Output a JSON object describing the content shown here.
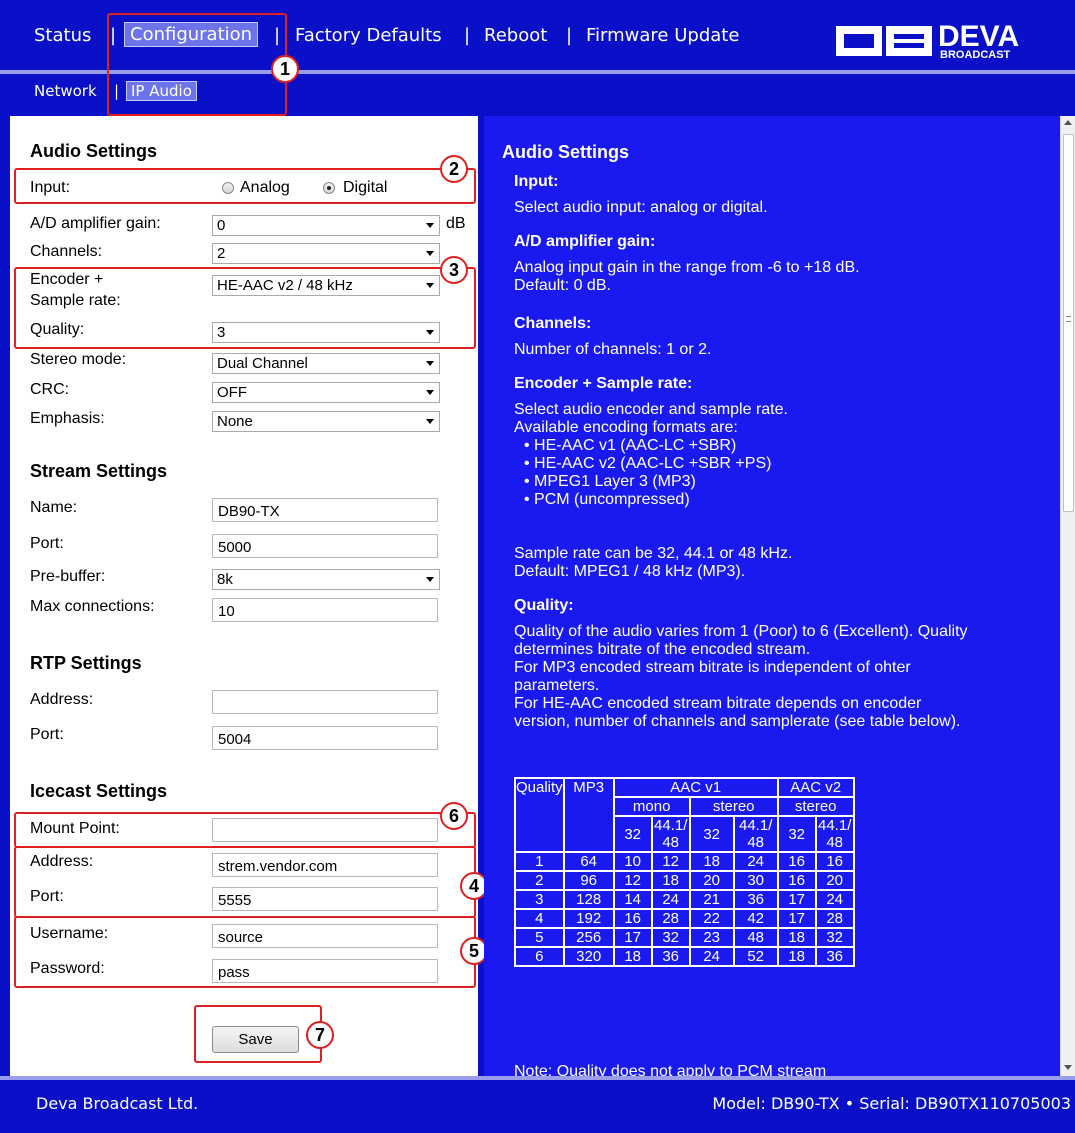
{
  "nav": {
    "items": [
      "Status",
      "Configuration",
      "Factory Defaults",
      "Reboot",
      "Firmware Update"
    ],
    "active": "Configuration",
    "separator": "|"
  },
  "subnav": {
    "items": [
      "Network",
      "IP Audio"
    ],
    "active": "IP Audio",
    "separator": "|"
  },
  "logo": {
    "main": "DEVA",
    "sub": "BROADCAST"
  },
  "audio": {
    "heading": "Audio Settings",
    "input_label": "Input:",
    "input_options": [
      "Analog",
      "Digital"
    ],
    "input_selected": "Digital",
    "gain_label": "A/D amplifier gain:",
    "gain_value": "0",
    "gain_unit": "dB",
    "channels_label": "Channels:",
    "channels_value": "2",
    "encoder_label_1": "Encoder +",
    "encoder_label_2": "Sample rate:",
    "encoder_value": "HE-AAC v2 / 48 kHz",
    "quality_label": "Quality:",
    "quality_value": "3",
    "stereo_label": "Stereo mode:",
    "stereo_value": "Dual Channel",
    "crc_label": "CRC:",
    "crc_value": "OFF",
    "emphasis_label": "Emphasis:",
    "emphasis_value": "None"
  },
  "stream": {
    "heading": "Stream Settings",
    "name_label": "Name:",
    "name_value": "DB90-TX",
    "port_label": "Port:",
    "port_value": "5000",
    "prebuffer_label": "Pre-buffer:",
    "prebuffer_value": "8k",
    "maxconn_label": "Max connections:",
    "maxconn_value": "10"
  },
  "rtp": {
    "heading": "RTP Settings",
    "address_label": "Address:",
    "address_value": "",
    "port_label": "Port:",
    "port_value": "5004"
  },
  "icecast": {
    "heading": "Icecast Settings",
    "mount_label": "Mount Point:",
    "mount_value": "",
    "address_label": "Address:",
    "address_value": "strem.vendor.com",
    "port_label": "Port:",
    "port_value": "5555",
    "username_label": "Username:",
    "username_value": "source",
    "password_label": "Password:",
    "password_value": "pass"
  },
  "save_label": "Save",
  "callouts": [
    "1",
    "2",
    "3",
    "4",
    "5",
    "6",
    "7"
  ],
  "help": {
    "heading": "Audio Settings",
    "input_h": "Input:",
    "input_t": "Select audio input: analog or digital.",
    "gain_h": "A/D amplifier gain:",
    "gain_t1": "Analog input gain in the range from -6 to +18 dB.",
    "gain_t2": "Default: 0 dB.",
    "channels_h": "Channels:",
    "channels_t": "Number of channels: 1 or 2.",
    "encoder_h": "Encoder + Sample rate:",
    "encoder_t1": "Select audio encoder and sample rate.",
    "encoder_t2": "Available encoding formats are:",
    "formats": [
      "HE-AAC v1 (AAC-LC +SBR)",
      "HE-AAC v2 (AAC-LC +SBR +PS)",
      "MPEG1 Layer 3 (MP3)",
      "PCM (uncompressed)"
    ],
    "encoder_t3": "Sample rate can be 32, 44.1 or 48 kHz.",
    "encoder_t4": "Default: MPEG1 / 48 kHz (MP3).",
    "quality_h": "Quality:",
    "quality_lines": [
      "Quality of the audio varies from 1 (Poor) to 6 (Excellent). Quality",
      "determines bitrate of the encoded stream.",
      "For MP3 encoded stream bitrate is independent of ohter",
      "parameters.",
      "For HE-AAC encoded stream bitrate depends on encoder",
      "version, number of channels and samplerate (see table below)."
    ],
    "note": "Note: Quality does not apply to PCM stream"
  },
  "table": {
    "h_quality": "Quality",
    "h_mp3": "MP3",
    "h_aacv1": "AAC v1",
    "h_aacv2": "AAC v2",
    "h_mono": "mono",
    "h_stereo1": "stereo",
    "h_stereo2": "stereo",
    "h_rates": [
      "32",
      "44.1/\n48",
      "32",
      "44.1/\n48",
      "32",
      "44.1/\n48"
    ],
    "rows": [
      [
        "1",
        "64",
        "10",
        "12",
        "18",
        "24",
        "16",
        "16"
      ],
      [
        "2",
        "96",
        "12",
        "18",
        "20",
        "30",
        "16",
        "20"
      ],
      [
        "3",
        "128",
        "14",
        "24",
        "21",
        "36",
        "17",
        "24"
      ],
      [
        "4",
        "192",
        "16",
        "28",
        "22",
        "42",
        "17",
        "28"
      ],
      [
        "5",
        "256",
        "17",
        "32",
        "23",
        "48",
        "18",
        "32"
      ],
      [
        "6",
        "320",
        "18",
        "36",
        "24",
        "52",
        "18",
        "36"
      ]
    ]
  },
  "footer": {
    "company": "Deva Broadcast Ltd.",
    "model": "Model: DB90-TX • Serial: DB90TX110705003"
  },
  "colors": {
    "nav_bg": "#0a10c8",
    "help_bg": "#1a1af0",
    "callout": "#e02020",
    "active_tab": "#6d73ea"
  }
}
